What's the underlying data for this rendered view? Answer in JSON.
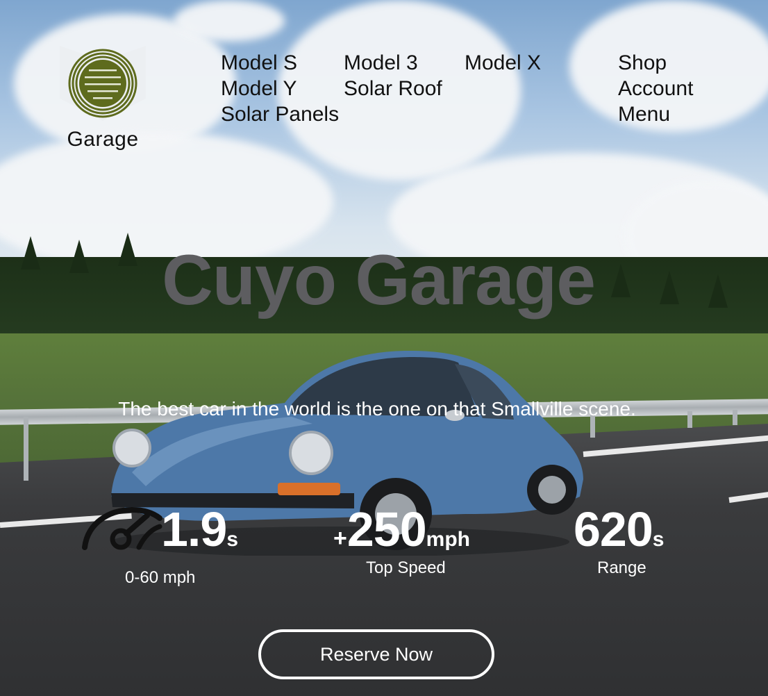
{
  "brand": {
    "logo_text": "Garage",
    "accent": "#5e6b1d"
  },
  "nav": {
    "items": [
      {
        "label": "Model S"
      },
      {
        "label": "Model 3"
      },
      {
        "label": "Model X"
      },
      {
        "label": "Model Y"
      },
      {
        "label": "Solar Roof"
      },
      {
        "label": "Solar Panels"
      }
    ],
    "right": [
      {
        "label": "Shop"
      },
      {
        "label": "Account"
      },
      {
        "label": "Menu"
      }
    ]
  },
  "hero": {
    "title": "Cuyo Garage",
    "tagline": "The best car in the world is the one on that Smallville scene."
  },
  "stats": [
    {
      "value": "1.9",
      "prefix": "",
      "unit": "s",
      "label": "0-60 mph"
    },
    {
      "value": "250",
      "prefix": "+",
      "unit": "mph",
      "label": "Top Speed"
    },
    {
      "value": "620",
      "prefix": "",
      "unit": "s",
      "label": "Range"
    }
  ],
  "cta": {
    "label": "Reserve Now"
  },
  "icons": {
    "speed": "speedometer-icon",
    "logo": "garage-logo-icon"
  },
  "colors": {
    "title": "#5d5d60",
    "text_light": "#ffffff",
    "car": "#4d78a8"
  }
}
